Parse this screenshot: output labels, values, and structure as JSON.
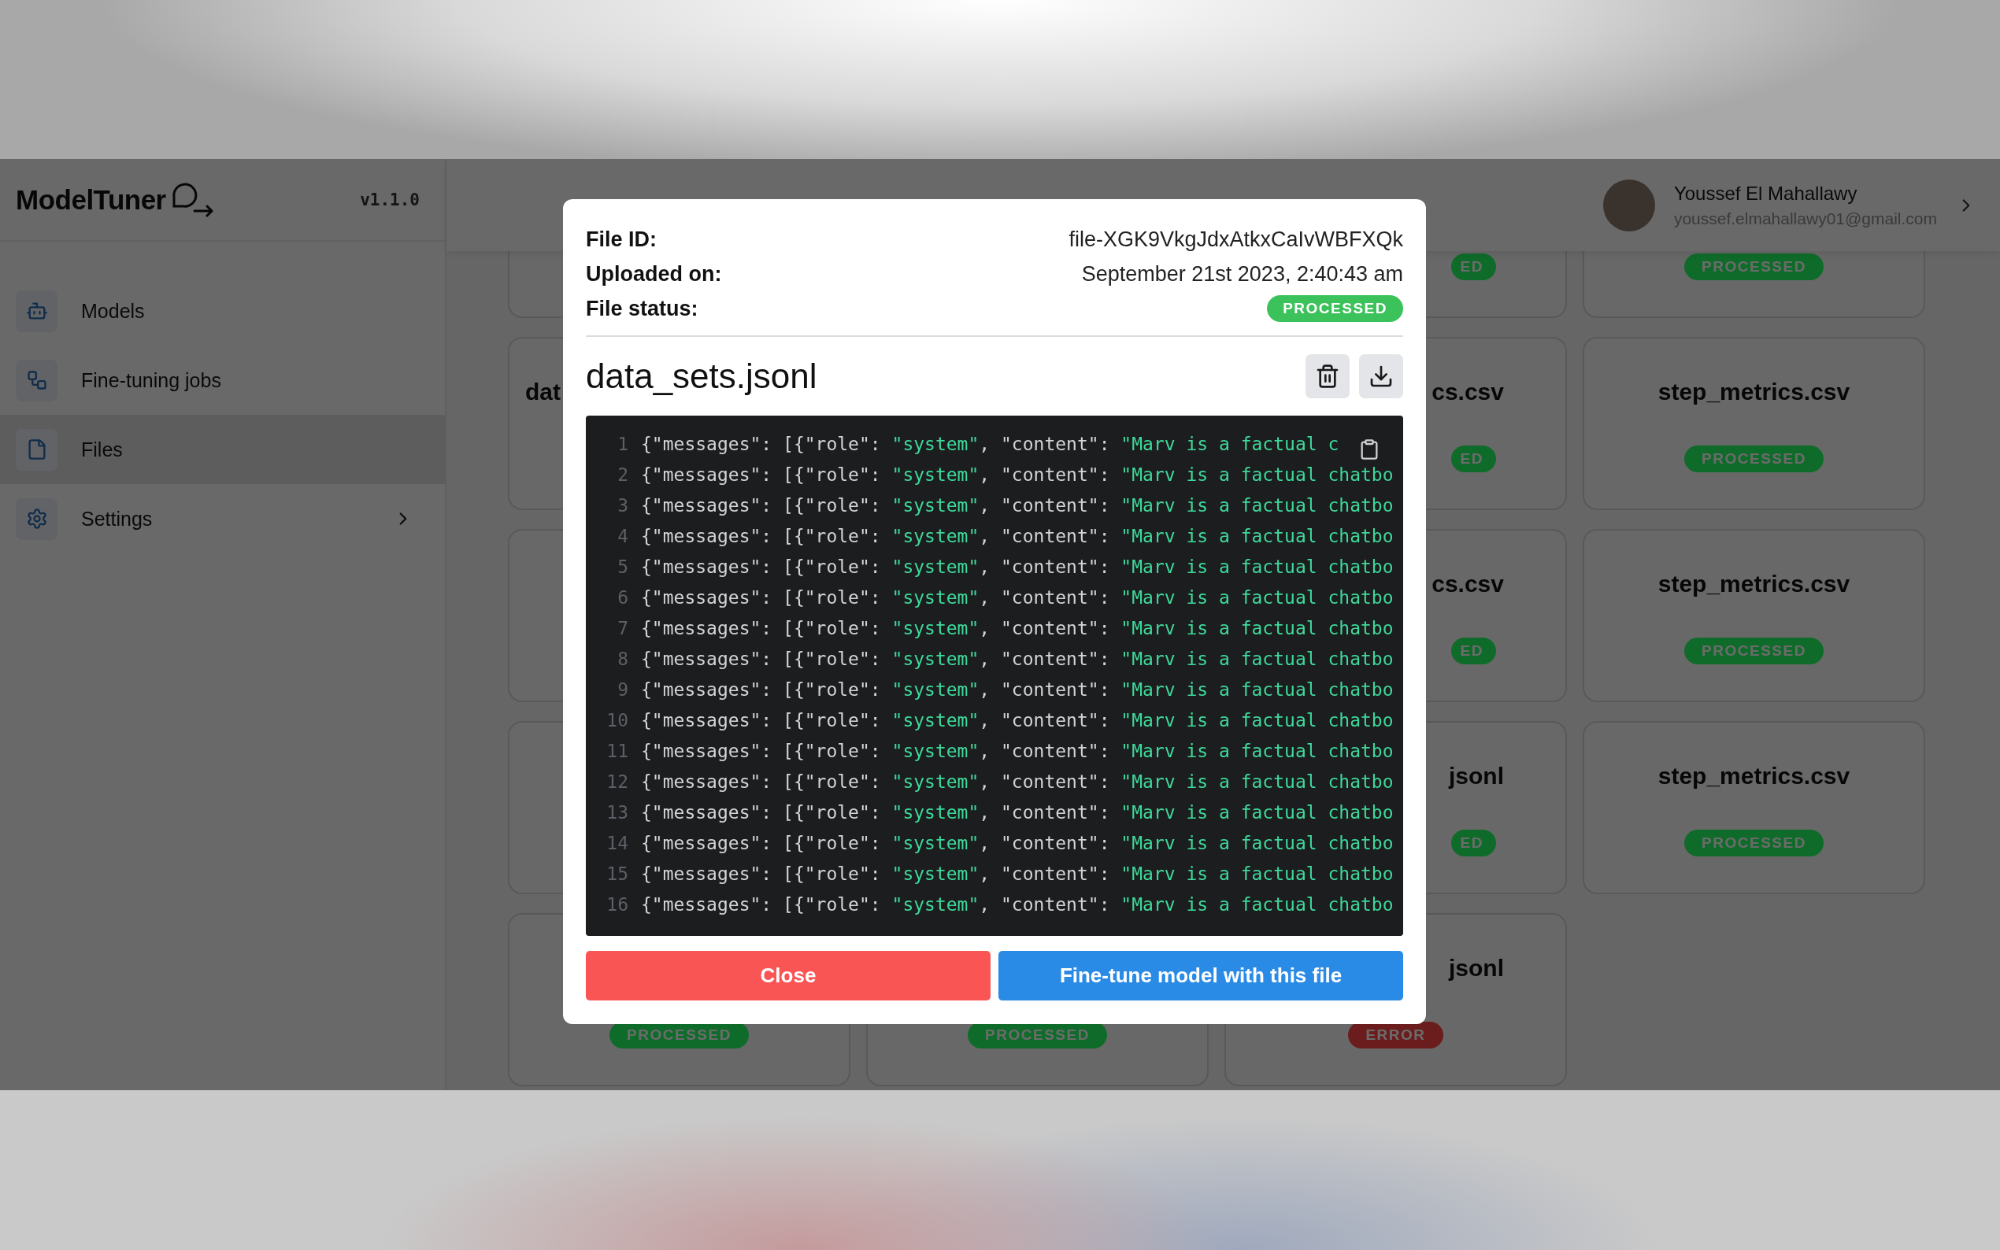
{
  "app": {
    "logo": "ModelTuner",
    "version": "v1.1.0"
  },
  "sidebar": {
    "items": [
      {
        "label": "Models",
        "kind": "bot",
        "selected": false,
        "has_submenu": false
      },
      {
        "label": "Fine-tuning jobs",
        "kind": "workflow",
        "selected": false,
        "has_submenu": false
      },
      {
        "label": "Files",
        "kind": "file",
        "selected": true,
        "has_submenu": false
      },
      {
        "label": "Settings",
        "kind": "settings",
        "selected": false,
        "has_submenu": true
      }
    ]
  },
  "user": {
    "name": "Youssef El Mahallawy",
    "email": "youssef.elmahallawy01@gmail.com"
  },
  "file_cards": [
    {
      "kind": "blank"
    },
    {
      "kind": "blank"
    },
    {
      "kind": "cut-right",
      "status": "ED",
      "color": "#0f6b2a"
    },
    {
      "kind": "full",
      "status": "PROCESSED",
      "color": "#0f6b2a"
    },
    {
      "kind": "cut-left",
      "title": "dat"
    },
    {
      "kind": "blank"
    },
    {
      "kind": "cut-right",
      "title": "cs.csv",
      "status": "ED",
      "color": "#0f6b2a"
    },
    {
      "kind": "full",
      "title": "step_metrics.csv",
      "status": "PROCESSED",
      "color": "#0f6b2a"
    },
    {
      "kind": "blank"
    },
    {
      "kind": "blank"
    },
    {
      "kind": "cut-right",
      "title": "cs.csv",
      "status": "ED",
      "color": "#0f6b2a"
    },
    {
      "kind": "full",
      "title": "step_metrics.csv",
      "status": "PROCESSED",
      "color": "#0f6b2a"
    },
    {
      "kind": "blank"
    },
    {
      "kind": "blank"
    },
    {
      "kind": "cut-right",
      "title": "jsonl",
      "status": "ED",
      "color": "#0f6b2a"
    },
    {
      "kind": "full",
      "title": "step_metrics.csv",
      "status": "PROCESSED",
      "color": "#0f6b2a"
    },
    {
      "kind": "full",
      "status": "PROCESSED",
      "color": "#0f6b2a"
    },
    {
      "kind": "full",
      "status": "PROCESSED",
      "color": "#0f6b2a"
    },
    {
      "kind": "cut-right-title",
      "title": "jsonl",
      "status": "ERROR",
      "color": "#6b1c1c"
    },
    {
      "kind": "none"
    }
  ],
  "modal": {
    "fields": [
      {
        "label": "File ID:",
        "value": "file-XGK9VkgJdxAtkxCaIvWBFXQk"
      },
      {
        "label": "Uploaded on:",
        "value": "September 21st 2023, 2:40:43 am"
      },
      {
        "label": "File status:",
        "status": "PROCESSED",
        "color": "#3cc25a"
      }
    ],
    "file_name": "data_sets.jsonl",
    "code_lines": [
      {
        "number": "1",
        "text": "{\"messages\": [{\"role\": \"system\", \"content\": \"Marv is a factual c"
      },
      {
        "number": "2",
        "text": "{\"messages\": [{\"role\": \"system\", \"content\": \"Marv is a factual chatbo"
      },
      {
        "number": "3",
        "text": "{\"messages\": [{\"role\": \"system\", \"content\": \"Marv is a factual chatbo"
      },
      {
        "number": "4",
        "text": "{\"messages\": [{\"role\": \"system\", \"content\": \"Marv is a factual chatbo"
      },
      {
        "number": "5",
        "text": "{\"messages\": [{\"role\": \"system\", \"content\": \"Marv is a factual chatbo"
      },
      {
        "number": "6",
        "text": "{\"messages\": [{\"role\": \"system\", \"content\": \"Marv is a factual chatbo"
      },
      {
        "number": "7",
        "text": "{\"messages\": [{\"role\": \"system\", \"content\": \"Marv is a factual chatbo"
      },
      {
        "number": "8",
        "text": "{\"messages\": [{\"role\": \"system\", \"content\": \"Marv is a factual chatbo"
      },
      {
        "number": "9",
        "text": "{\"messages\": [{\"role\": \"system\", \"content\": \"Marv is a factual chatbo"
      },
      {
        "number": "10",
        "text": "{\"messages\": [{\"role\": \"system\", \"content\": \"Marv is a factual chatbo"
      },
      {
        "number": "11",
        "text": "{\"messages\": [{\"role\": \"system\", \"content\": \"Marv is a factual chatbo"
      },
      {
        "number": "12",
        "text": "{\"messages\": [{\"role\": \"system\", \"content\": \"Marv is a factual chatbo"
      },
      {
        "number": "13",
        "text": "{\"messages\": [{\"role\": \"system\", \"content\": \"Marv is a factual chatbo"
      },
      {
        "number": "14",
        "text": "{\"messages\": [{\"role\": \"system\", \"content\": \"Marv is a factual chatbo"
      },
      {
        "number": "15",
        "text": "{\"messages\": [{\"role\": \"system\", \"content\": \"Marv is a factual chatbo"
      },
      {
        "number": "16",
        "text": "{\"messages\": [{\"role\": \"system\", \"content\": \"Marv is a factual chatbo"
      }
    ],
    "buttons": [
      {
        "label": "Close",
        "kind": "danger"
      },
      {
        "label": "Fine-tune model with this file",
        "kind": "primary"
      }
    ]
  }
}
